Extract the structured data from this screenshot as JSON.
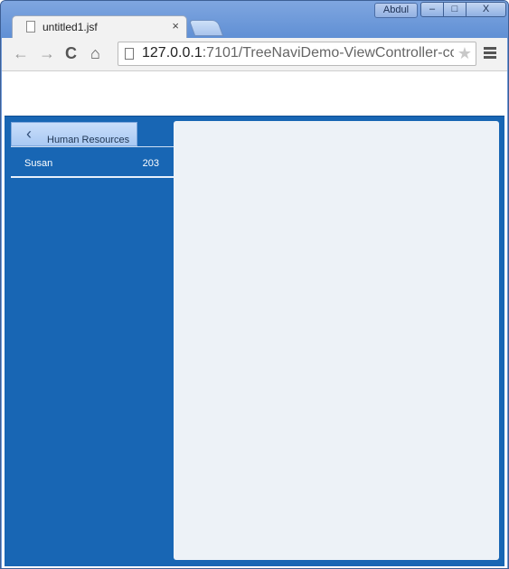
{
  "window": {
    "user": "Abdul",
    "controls": {
      "minimize": "–",
      "maximize": "□",
      "close": "X"
    }
  },
  "tab": {
    "title": "untitled1.jsf",
    "close": "×"
  },
  "toolbar": {
    "url_host": "127.0.0.1",
    "url_rest": ":7101/TreeNaviDemo-ViewController-co",
    "back": "←",
    "forward": "→",
    "reload": "C",
    "home": "⌂",
    "star": "★"
  },
  "app": {
    "back_button": {
      "label": "Human Resources",
      "icon": "chevron-left-icon"
    },
    "tree": {
      "items": [
        {
          "name": "Susan",
          "count": "203"
        }
      ]
    }
  },
  "colors": {
    "app_background": "#1866b4",
    "detail_panel": "#edf2f7",
    "back_button": "#b9d4f6"
  }
}
